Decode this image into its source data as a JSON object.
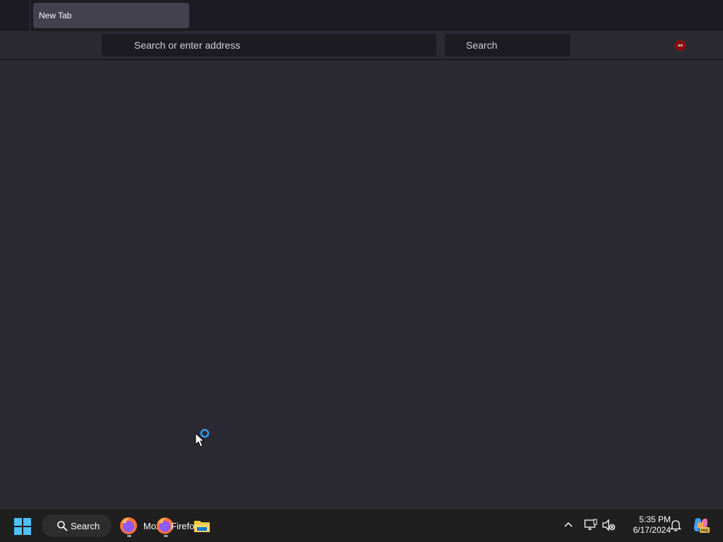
{
  "browser": {
    "tabs": [
      {
        "title": "New Tab"
      }
    ],
    "urlbar": {
      "placeholder": "Search or enter address"
    },
    "searchbar": {
      "placeholder": "Search"
    },
    "extension": {
      "icon": "ublock-origin-icon",
      "badge_text": "uo",
      "color": "#800000"
    }
  },
  "taskbar": {
    "search_label": "Search",
    "apps": [
      {
        "name": "firefox-icon",
        "label": "Moz"
      },
      {
        "name": "firefox-icon",
        "label": "Firefox"
      },
      {
        "name": "file-explorer-icon",
        "label": ""
      }
    ],
    "tray": {
      "chevron": "chevron-up-icon",
      "network": "network-icon",
      "volume": "volume-muted-icon",
      "notifications": "bell-icon",
      "copilot": "copilot-icon",
      "copilot_badge": "PRE"
    },
    "clock": {
      "time": "5:35 PM",
      "date": "6/17/2024"
    }
  },
  "colors": {
    "tab_bg": "#1c1b22",
    "active_tab": "#42414d",
    "toolbar_bg": "#2b2a33",
    "field_bg": "#1c1b22",
    "taskbar_bg": "#1f1f1f",
    "accent_blue": "#0078d4"
  }
}
